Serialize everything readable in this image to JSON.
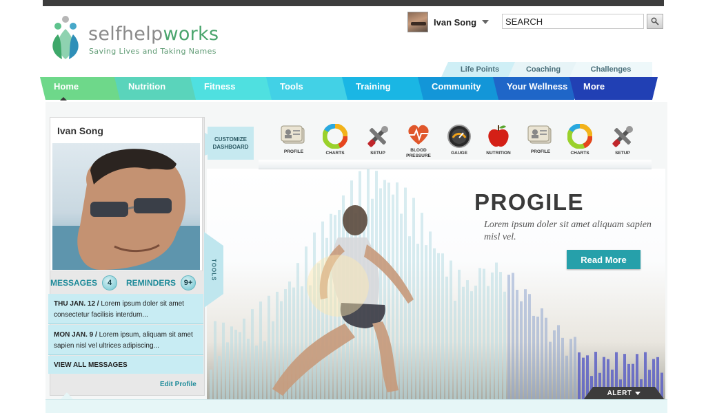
{
  "brand": {
    "name_a": "selfhelp",
    "name_b": "works",
    "tagline": "Saving Lives and Taking Names"
  },
  "user": {
    "name": "Ivan Song"
  },
  "search": {
    "value": "SEARCH"
  },
  "subtabs": [
    {
      "label": "Life Points"
    },
    {
      "label": "Coaching"
    },
    {
      "label": "Challenges"
    }
  ],
  "nav": [
    {
      "label": "Home",
      "color": "#6ed88a"
    },
    {
      "label": "Nutrition",
      "color": "#5ad4bb"
    },
    {
      "label": "Fitness",
      "color": "#4fe0e0"
    },
    {
      "label": "Tools",
      "color": "#42d1e6"
    },
    {
      "label": "Training",
      "color": "#1ab6e4"
    },
    {
      "label": "Community",
      "color": "#1396d8"
    },
    {
      "label": "Your Wellness",
      "color": "#1f66c8"
    },
    {
      "label": "More",
      "color": "#2140b4"
    }
  ],
  "dashboard": {
    "customize": "CUSTOMIZE DASHBOARD",
    "icons": [
      {
        "label": "PROFILE",
        "icon": "profile-icon"
      },
      {
        "label": "CHARTS",
        "icon": "charts-icon"
      },
      {
        "label": "SETUP",
        "icon": "setup-icon"
      },
      {
        "label": "BLOOD PRESSURE",
        "icon": "blood-pressure-icon"
      },
      {
        "label": "GAUGE",
        "icon": "gauge-icon"
      },
      {
        "label": "NUTRITION",
        "icon": "nutrition-icon"
      },
      {
        "label": "PROFILE",
        "icon": "profile-icon"
      },
      {
        "label": "CHARTS",
        "icon": "charts-icon"
      },
      {
        "label": "SETUP",
        "icon": "setup-icon"
      }
    ]
  },
  "profile": {
    "name": "Ivan Song",
    "tools": "TOOLS",
    "edit": "Edit Profile"
  },
  "messages": {
    "tab_label": "MESSAGES",
    "tab_count": "4",
    "reminders_label": "REMINDERS",
    "reminders_count": "9+",
    "items": [
      {
        "date": "THU JAN. 12 /",
        "text": "Lorem ipsum doler sit amet consectetur facilisis interdum..."
      },
      {
        "date": "MON JAN. 9 /",
        "text": "Lorem ipsum, aliquam sit amet sapien nisl vel ultrices adipiscing..."
      }
    ],
    "view_all": "VIEW ALL MESSAGES"
  },
  "hero": {
    "title": "PROGILE",
    "text": "Lorem ipsum doler sit amet aliquam sapien misl vel.",
    "button": "Read More"
  },
  "alert": {
    "label": "ALERT"
  }
}
